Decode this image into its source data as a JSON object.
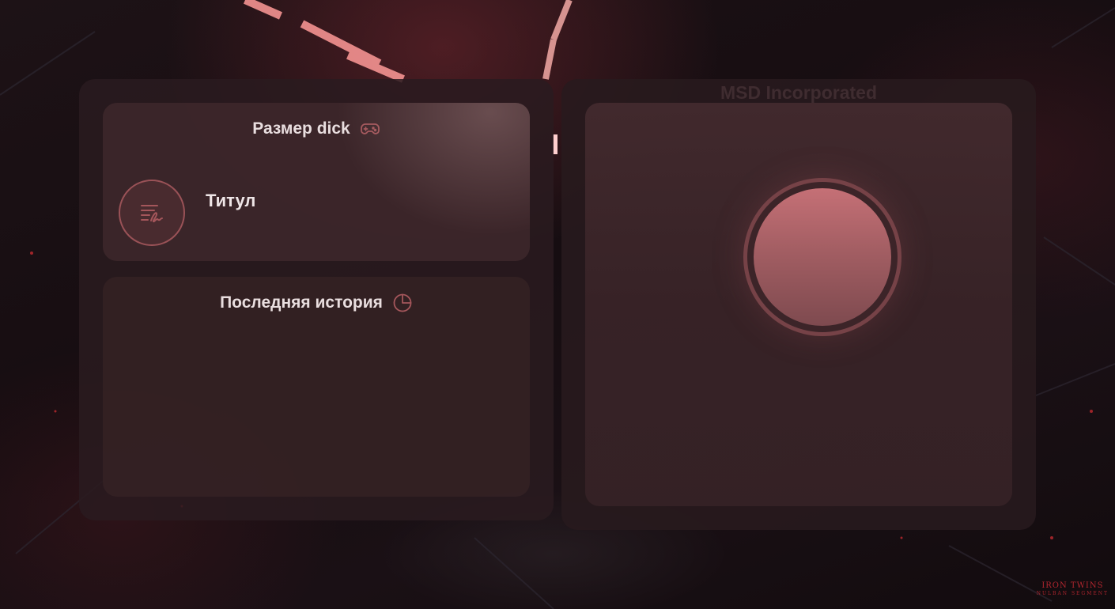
{
  "size_card": {
    "title": "Размер dick",
    "icon": "gamepad-icon",
    "item_label": "Титул",
    "item_icon": "signature-list-icon"
  },
  "history_card": {
    "title": "Последняя история",
    "icon": "pie-clock-icon"
  },
  "right_panel": {
    "brand": "MSD Incorporated",
    "main_button_icon": "circle-button"
  },
  "watermark": {
    "line1": "IRON TWINS",
    "line2": "NULBAN SEGMENT"
  },
  "colors": {
    "accent": "#b5656b",
    "icon_stroke": "#a4565b",
    "panel": "#2a1b1f",
    "card": "#3e282c",
    "text": "#e9dedf"
  }
}
